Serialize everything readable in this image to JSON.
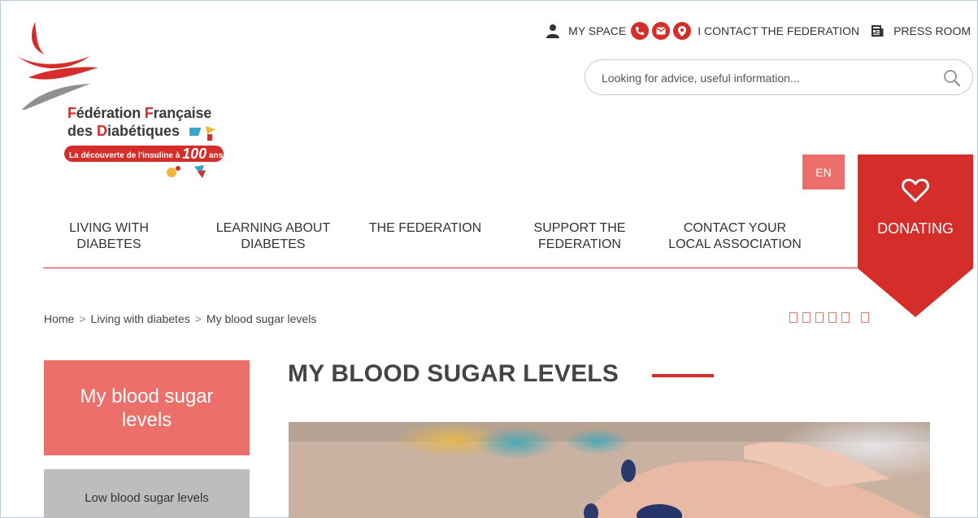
{
  "logo": {
    "line1_first_letter": "F",
    "line1_rest_a": "édération ",
    "line1_second_letter": "F",
    "line1_rest_b": "rançaise",
    "line2_prefix": "des ",
    "line2_letter": "D",
    "line2_rest": "iabétiques",
    "tagline_prefix": "La découverte de l'insuline à ",
    "tagline_number": "100",
    "tagline_suffix": "ans !"
  },
  "topbar": {
    "my_space": "MY SPACE",
    "contact_federation": "I CONTACT THE FEDERATION",
    "press_room": "PRESS ROOM"
  },
  "search": {
    "placeholder": "Looking for advice, useful information..."
  },
  "lang": "EN",
  "donate": "DONATING",
  "nav": {
    "items": [
      {
        "line1": "LIVING WITH",
        "line2": "DIABETES"
      },
      {
        "line1": "LEARNING ABOUT",
        "line2": "DIABETES"
      },
      {
        "line1": "THE FEDERATION",
        "line2": ""
      },
      {
        "line1": "SUPPORT THE",
        "line2": "FEDERATION"
      },
      {
        "line1": "CONTACT YOUR",
        "line2": "LOCAL ASSOCIATION"
      }
    ]
  },
  "breadcrumb": {
    "home": "Home",
    "separator": ">",
    "level1": "Living with diabetes",
    "current": "My blood sugar levels"
  },
  "sidebar": {
    "active": "My blood sugar levels",
    "items": [
      "Low blood sugar levels"
    ]
  },
  "main": {
    "title": "MY BLOOD SUGAR LEVELS"
  },
  "colors": {
    "brand_red": "#d42d2a",
    "salmon": "#ec6f6b",
    "sidebar_grey": "#bdbdbd"
  }
}
